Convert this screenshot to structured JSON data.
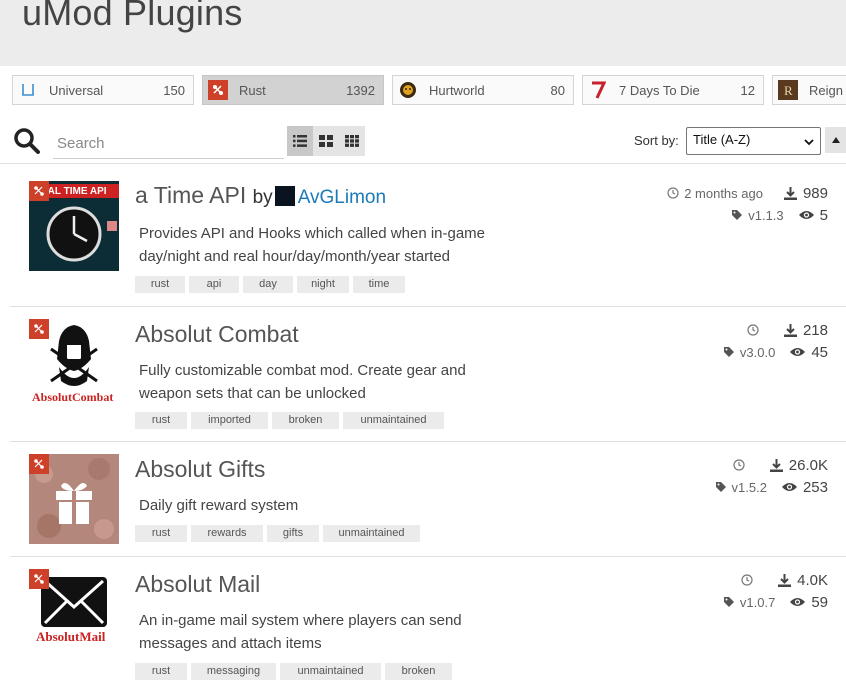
{
  "header": {
    "title": "uMod Plugins"
  },
  "games": [
    {
      "name": "Universal",
      "count": "150",
      "active": false
    },
    {
      "name": "Rust",
      "count": "1392",
      "active": true
    },
    {
      "name": "Hurtworld",
      "count": "80",
      "active": false
    },
    {
      "name": "7 Days To Die",
      "count": "12",
      "active": false
    },
    {
      "name": "Reign o",
      "count": "",
      "active": false
    }
  ],
  "toolbar": {
    "search_placeholder": "Search",
    "sort_label": "Sort by:",
    "sort_value": "Title (A-Z)",
    "view_modes": [
      "list",
      "grid-large",
      "grid-small"
    ]
  },
  "plugins": [
    {
      "title": "a Time API",
      "by": "by",
      "author": "AvGLimon",
      "description": "Provides API and Hooks which called when in-game day/night and real hour/day/month/year started",
      "tags": [
        "rust",
        "api",
        "day",
        "night",
        "time"
      ],
      "updated": "2 months ago",
      "downloads": "989",
      "version": "v1.1.3",
      "views": "5",
      "thumb_text": "EAL TIME API"
    },
    {
      "title": "Absolut Combat",
      "description": "Fully customizable combat mod. Create gear and weapon sets that can be unlocked",
      "tags": [
        "rust",
        "imported",
        "broken",
        "unmaintained"
      ],
      "updated": "",
      "downloads": "218",
      "version": "v3.0.0",
      "views": "45",
      "thumb_text": "AbsolutCombat"
    },
    {
      "title": "Absolut Gifts",
      "description": "Daily gift reward system",
      "tags": [
        "rust",
        "rewards",
        "gifts",
        "unmaintained"
      ],
      "updated": "",
      "downloads": "26.0K",
      "version": "v1.5.2",
      "views": "253"
    },
    {
      "title": "Absolut Mail",
      "description": "An in-game mail system where players can send messages and attach items",
      "tags": [
        "rust",
        "messaging",
        "unmaintained",
        "broken"
      ],
      "updated": "",
      "downloads": "4.0K",
      "version": "v1.0.7",
      "views": "59",
      "thumb_text": "AbsolutMail"
    }
  ],
  "colors": {
    "rust_red": "#cd412b",
    "link_blue": "#1b7ab8",
    "header_bg": "#ececec"
  }
}
